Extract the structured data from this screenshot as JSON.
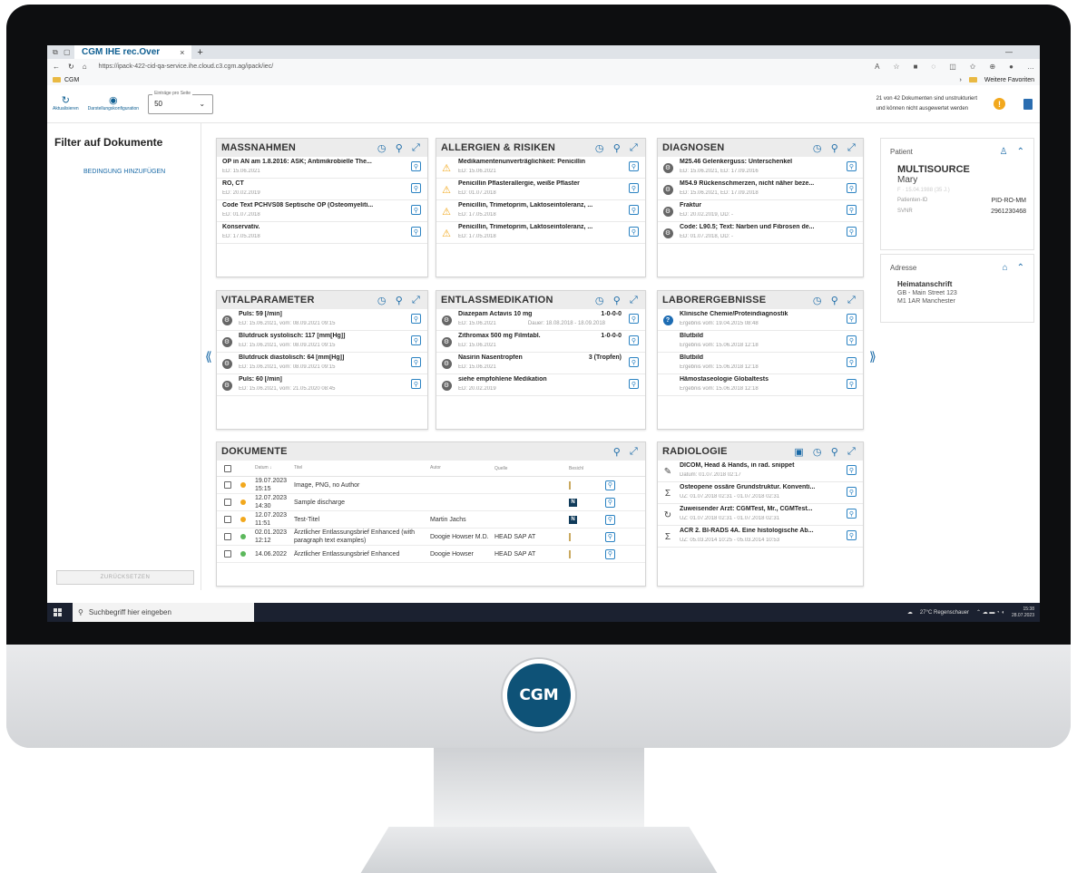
{
  "browser": {
    "tab_title": "CGM IHE rec.Over",
    "url": "https://ipack-422-cid-qa-service.ihe.cloud.c3.cgm.ag/ipack/iec/",
    "fav_folder": "CGM",
    "fav_other": "Weitere Favoriten"
  },
  "toolbar": {
    "refresh_label": "Aktualisieren",
    "settings_label": "Darstellungskonfiguration",
    "entries_label": "Einträge pro Seite",
    "entries_value": "50",
    "notice_line1": "21 von 42 Dokumenten sind unstrukturiert",
    "notice_line2": "und können nicht ausgewertet werden"
  },
  "filter": {
    "title": "Filter auf Dokumente",
    "add_condition": "BEDINGUNG HINZUFÜGEN",
    "reset": "ZURÜCKSETZEN"
  },
  "panels": {
    "massnahmen": {
      "title": "MASSNAHMEN",
      "rows": [
        {
          "t": "OP in AN am 1.8.2016: ASK; Antimikrobielle The...",
          "d": "ED: 15.06.2021"
        },
        {
          "t": "RÖ, CT",
          "d": "ED: 20.02.2019"
        },
        {
          "t": "Code Text PCHVS08 Septische OP (Osteomyeliti...",
          "d": "ED: 01.07.2018"
        },
        {
          "t": "Konservativ.",
          "d": "ED: 17.05.2018"
        }
      ]
    },
    "allergien": {
      "title": "ALLERGIEN & RISIKEN",
      "rows": [
        {
          "t": "Medikamentenunverträglichkeit: Penicillin",
          "d": "ED: 15.06.2021"
        },
        {
          "t": "Penicillin Pflasterallergie, weiße Pflaster",
          "d": "ED: 01.07.2018"
        },
        {
          "t": "Penicillin, Trimetoprim, Laktoseintoleranz, ...",
          "d": "ED: 17.05.2018"
        },
        {
          "t": "Penicillin, Trimetoprim, Laktoseintoleranz, ...",
          "d": "ED: 17.05.2018"
        }
      ]
    },
    "diagnosen": {
      "title": "DIAGNOSEN",
      "rows": [
        {
          "t": "M25.46 Gelenkerguss: Unterschenkel",
          "d": "ED: 15.06.2021, ED: 17.09.2016"
        },
        {
          "t": "M54.9 Rückenschmerzen, nicht näher beze...",
          "d": "ED: 15.06.2021, ED: 17.09.2018"
        },
        {
          "t": "Fraktur",
          "d": "ED: 20.02.2019, DD: -"
        },
        {
          "t": "Code: L90.5; Text: Narben und Fibrosen de...",
          "d": "ED: 01.07.2018, DD: -"
        }
      ]
    },
    "vital": {
      "title": "VITALPARAMETER",
      "rows": [
        {
          "t": "Puls: 59 [/min]",
          "d": "ED: 15.06.2021, vom: 08.09.2021 09:15"
        },
        {
          "t": "Blutdruck systolisch: 117 [mm[Hg]]",
          "d": "ED: 15.06.2021, vom: 08.09.2021 09:15"
        },
        {
          "t": "Blutdruck diastolisch: 64 [mm[Hg]]",
          "d": "ED: 15.06.2021, vom: 08.09.2021 09:15"
        },
        {
          "t": "Puls: 60 [/min]",
          "d": "ED: 15.06.2021, vom: 21.05.2020 08:45"
        }
      ]
    },
    "entlass": {
      "title": "ENTLASSMEDIKATION",
      "rows": [
        {
          "t": "Diazepam Actavis 10 mg",
          "d": "ED: 15.06.2021",
          "r": "1-0-0-0",
          "dd": "Dauer: 18.08.2018 - 18.09.2018"
        },
        {
          "t": "Zithromax 500 mg Filmtabl.",
          "d": "ED: 15.06.2021",
          "r": "1-0-0-0",
          "dd": ""
        },
        {
          "t": "Nasirin Nasentropfen",
          "d": "ED: 15.06.2021",
          "r": "3 (Tropfen)",
          "dd": ""
        },
        {
          "t": "siehe empfohlene Medikation",
          "d": "ED: 20.02.2019",
          "r": "",
          "dd": ""
        }
      ]
    },
    "labor": {
      "title": "LABORERGEBNISSE",
      "rows": [
        {
          "t": "Klinische Chemie/Proteindiagnostik",
          "d": "Ergebnis vom: 19.04.2015 08:48"
        },
        {
          "t": "Blutbild",
          "d": "Ergebnis vom: 15.06.2018 12:18"
        },
        {
          "t": "Blutbild",
          "d": "Ergebnis vom: 15.06.2018 12:18"
        },
        {
          "t": "Hämostaseologie Globaltests",
          "d": "Ergebnis vom: 15.06.2018 12:18"
        }
      ]
    },
    "dokumente": {
      "title": "DOKUMENTE",
      "head": {
        "date": "Datum ↓",
        "title": "Titel",
        "author": "Autor",
        "source": "Quelle",
        "vis": "Besichl"
      },
      "rows": [
        {
          "date": "19.07.2023 15:15",
          "title": "Image, PNG, no Author",
          "author": "",
          "source": "",
          "color": "#f2a81d",
          "icon": "folder"
        },
        {
          "date": "12.07.2023 14:30",
          "title": "Sample discharge",
          "author": "",
          "source": "",
          "color": "#f2a81d",
          "icon": "N"
        },
        {
          "date": "12.07.2023 11:51",
          "title": "Test-Titel",
          "author": "Martin Jachs",
          "source": "",
          "color": "#f2a81d",
          "icon": "N"
        },
        {
          "date": "02.01.2023 12:12",
          "title": "Ärztlicher Entlassungsbrief Enhanced (with paragraph text examples)",
          "author": "Doogie Howser M.D.",
          "source": "HEAD SAP AT",
          "color": "#5cb85c",
          "icon": "folder"
        },
        {
          "date": "14.06.2022",
          "title": "Ärztlicher Entlassungsbrief Enhanced",
          "author": "Doogie Howser",
          "source": "HEAD SAP AT",
          "color": "#5cb85c",
          "icon": "folder"
        }
      ]
    },
    "radiologie": {
      "title": "RADIOLOGIE",
      "rows": [
        {
          "t": "DICOM, Head & Hands, in rad. snippet",
          "d": "Datum: 01.07.2018 02:17"
        },
        {
          "t": "Osteopene ossäre Grundstruktur. Konventi...",
          "d": "UZ: 01.07.2018 02:31 - 01.07.2018 02:31"
        },
        {
          "t": "Zuweisender Arzt: CGMTest, Mr., CGMTest...",
          "d": "UZ: 01.07.2018 02:31 - 01.07.2018 02:31"
        },
        {
          "t": "ACR 2. BI-RADS 4A. Eine histologische Ab...",
          "d": "UZ: 05.03.2014 10:25 - 05.03.2014 10:53"
        }
      ]
    }
  },
  "patient": {
    "header": "Patient",
    "last": "MULTISOURCE",
    "first": "Mary",
    "blur": "F · 15.04.1988 (35 J.)",
    "id_label": "Patienten-ID",
    "id_value": "PID-RO-MM",
    "svnr_label": "SVNR",
    "svnr_value": "2961230468"
  },
  "address": {
    "header": "Adresse",
    "type": "Heimatanschrift",
    "line1": "GB - Main Street 123",
    "line2": "M1 1AR Manchester"
  },
  "taskbar": {
    "search": "Suchbegriff hier eingeben",
    "weather": "27°C Regenschauer",
    "time": "15:38",
    "date": "28.07.2023"
  },
  "logo": "CGM"
}
